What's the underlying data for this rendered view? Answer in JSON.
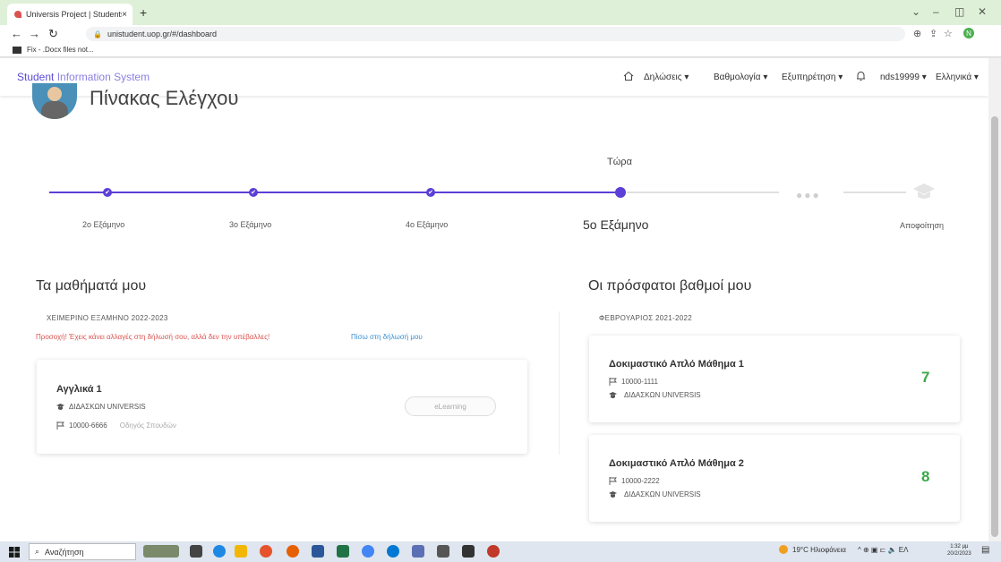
{
  "browser": {
    "tab_title": "Universis Project | Students Appl",
    "tab_close": "×",
    "new_tab": "+",
    "minimize": "⌄",
    "restore": "–",
    "maximize": "◫",
    "close": "✕",
    "url": "unistudent.uop.gr/#/dashboard",
    "bookmark": "Fix - .Docx files not..."
  },
  "header": {
    "brand_bold": "Student",
    "brand_light": "Information System",
    "nav": {
      "declarations": "Δηλώσεις ▾",
      "grades": "Βαθμολογία ▾",
      "service": "Εξυπηρέτηση ▾",
      "user": "nds19999 ▾",
      "language": "Ελληνικά ▾"
    }
  },
  "page_title": "Πίνακας Ελέγχου",
  "timeline": {
    "now_label": "Τώρα",
    "semesters": [
      "2ο Εξάμηνο",
      "3ο Εξάμηνο",
      "4ο Εξάμηνο"
    ],
    "current": "5ο Εξάμηνο",
    "ellipsis": "●●●",
    "graduation": "Αποφοίτηση"
  },
  "my_courses": {
    "heading": "Τα μαθήματά μου",
    "period": "ΧΕΙΜΕΡΙΝΟ ΕΞΑΜΗΝΟ 2022-2023",
    "warning": "Προσοχή! Έχεις κάνει αλλαγές στη δήλωσή σου, αλλά δεν την υπέβαλλες!",
    "back_link": "Πίσω στη δήλωσή μου",
    "course": {
      "title": "Αγγλικά 1",
      "instructor": "ΔΙΔΑΣΚΩΝ UNIVERSIS",
      "code": "10000-6666",
      "guide": "Οδηγός Σπουδών",
      "elearning": "eLearning"
    }
  },
  "recent_grades": {
    "heading": "Οι πρόσφατοι βαθμοί μου",
    "period": "ΦΕΒΡΟΥΑΡΙΟΣ 2021-2022",
    "items": [
      {
        "title": "Δοκιμαστικό Απλό Μάθημα 1",
        "code": "10000-1111",
        "instructor": "ΔΙΔΑΣΚΩΝ UNIVERSIS",
        "grade": "7"
      },
      {
        "title": "Δοκιμαστικό Απλό Μάθημα 2",
        "code": "10000-2222",
        "instructor": "ΔΙΔΑΣΚΩΝ UNIVERSIS",
        "grade": "8"
      }
    ]
  },
  "taskbar": {
    "search": "Αναζήτηση",
    "weather": "19°C Ηλιοφάνεια",
    "tray": "^ ⊕ ▣ ⊏ 🔈 ΕΛ",
    "time": "1:32 μμ",
    "date": "20/2/2023",
    "notif": "▤"
  },
  "colors": {
    "accent": "#5c3fd6",
    "grade": "#3ca84a",
    "warning": "#d9534f",
    "link": "#3b8fd0"
  }
}
